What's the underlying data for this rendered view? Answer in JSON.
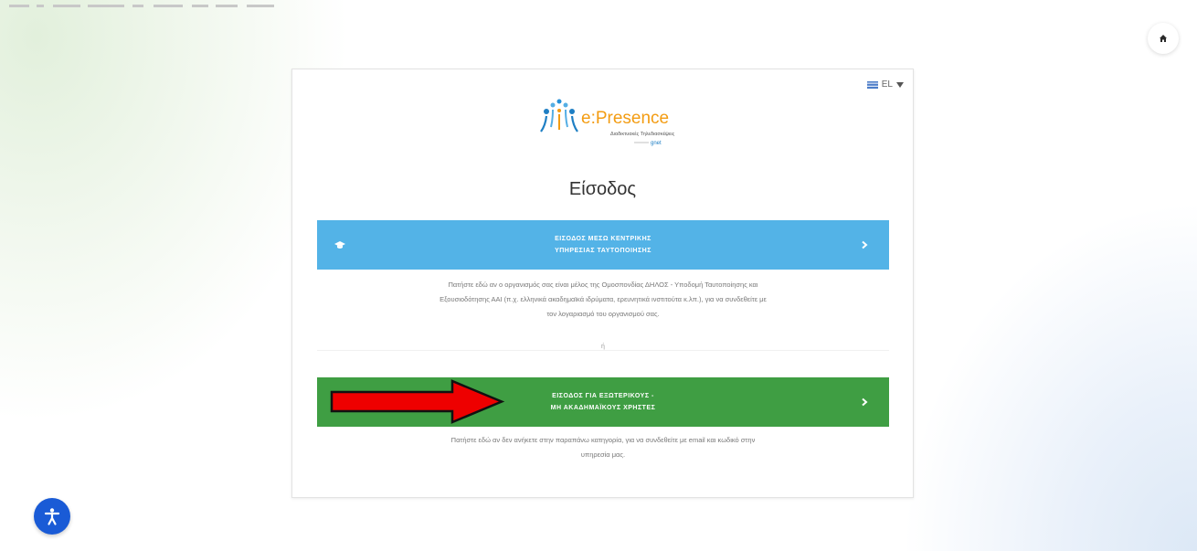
{
  "language": {
    "label": "EL"
  },
  "logo": {
    "brand": "e:Presence",
    "subtitle": "Διαδικτυακές Τηλεδιασκέψεις",
    "provider": "gnet"
  },
  "page": {
    "title": "Είσοδος"
  },
  "central_login": {
    "label_line1": "ΕΙΣΟΔΟΣ ΜΕΣΩ ΚΕΝΤΡΙΚΗΣ",
    "label_line2": "ΥΠΗΡΕΣΙΑΣ ΤΑΥΤΟΠΟΙΗΣΗΣ",
    "description_line1": "Πατήστε εδώ αν ο οργανισμός σας είναι μέλος της Ομοσπονδίας ΔΗΛΟΣ - Υποδομή Ταυτοποίησης και",
    "description_line2": "Εξουσιοδότησης ΑΑΙ (π.χ. ελληνικά ακαδημαϊκά ιδρύματα, ερευνητικά ινστιτούτα κ.λπ.), για να συνδεθείτε με",
    "description_line3": "τον λογαριασμό του οργανισμού σας."
  },
  "separator": {
    "label": "ή"
  },
  "external_login": {
    "label_line1": "ΕΙΣΟΔΟΣ ΓΙΑ ΕΞΩΤΕΡΙΚΟΥΣ -",
    "label_line2": "ΜΗ ΑΚΑΔΗΜΑΪΚΟΥΣ ΧΡΗΣΤΕΣ",
    "description_line1": "Πατήστε εδώ αν δεν ανήκετε στην παραπάνω κατηγορία, για να συνδεθείτε με email και κωδικό στην",
    "description_line2": "υπηρεσία μας."
  },
  "colors": {
    "primary_blue": "#53b3e7",
    "secondary_green": "#3f9e43",
    "annotation_red": "#ee0000",
    "accessibility_blue": "#1a5bd6",
    "logo_orange": "#f39c12"
  },
  "icons": {
    "home": "home-icon",
    "language": "flag-icon",
    "dropdown": "caret-down-icon",
    "central": "graduation-cap-icon",
    "chevron": "chevron-right-icon",
    "accessibility": "accessibility-icon",
    "annotation": "red-arrow-icon"
  }
}
